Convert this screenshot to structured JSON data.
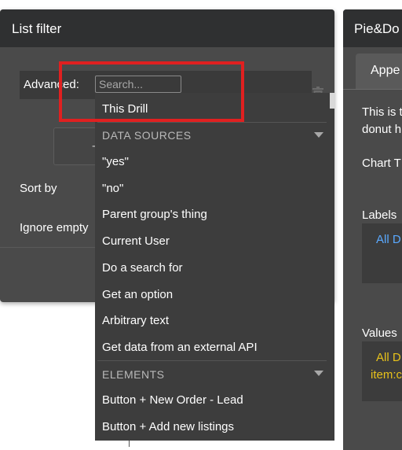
{
  "list_filter": {
    "title": "List filter",
    "advanced_label": "Advanced:",
    "search_placeholder": "Search...",
    "button_fragment": "-",
    "sort_by_label": "Sort by",
    "ignore_empty_label": "Ignore empty"
  },
  "dropdown": {
    "top_item": "This Drill",
    "sections": [
      {
        "title": "DATA SOURCES",
        "items": [
          "\"yes\"",
          "\"no\"",
          "Parent group's thing",
          "Current User",
          "Do a search for",
          "Get an option",
          "Arbitrary text",
          "Get data from an external API"
        ]
      },
      {
        "title": "ELEMENTS",
        "items": [
          "Button + New Order - Lead",
          "Button + Add new listings"
        ]
      }
    ]
  },
  "pie_panel": {
    "title": "Pie&Do",
    "tab": "Appe",
    "desc_line1": "This is t",
    "desc_line2": "donut h",
    "chart_type_label": "Chart T",
    "labels_label": "Labels",
    "labels_value": "All D",
    "values_label": "Values",
    "values_value_line1": "All D",
    "values_value_line2": "item:c"
  },
  "colors": {
    "panel_bg": "#4a4a4a",
    "header_bg": "#2f3031",
    "dropdown_bg": "#3d3d3d",
    "highlight": "#e02020",
    "link_blue": "#5aa9ff",
    "expr_yellow": "#e8c21a"
  },
  "icons": {
    "trash": "trash-icon",
    "section_caret": "chevron-down-icon"
  }
}
